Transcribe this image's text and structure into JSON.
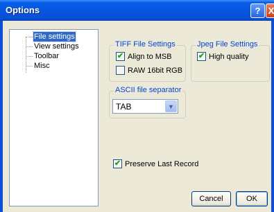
{
  "window": {
    "title": "Options",
    "help_glyph": "?",
    "close_glyph": "X"
  },
  "tree": {
    "items": [
      {
        "label": "File settings",
        "selected": true
      },
      {
        "label": "View settings",
        "selected": false
      },
      {
        "label": "Toolbar",
        "selected": false
      },
      {
        "label": "Misc",
        "selected": false
      }
    ]
  },
  "tiff": {
    "legend": "TIFF File Settings",
    "align_msb": {
      "label": "Align to MSB",
      "checked": true
    },
    "raw16": {
      "label": "RAW 16bit RGB",
      "checked": false
    }
  },
  "jpeg": {
    "legend": "Jpeg File Settings",
    "high_quality": {
      "label": "High quality",
      "checked": true
    }
  },
  "ascii": {
    "legend": "ASCII file separator",
    "value": "TAB"
  },
  "preserve": {
    "label": "Preserve Last Record",
    "checked": true
  },
  "buttons": {
    "cancel": "Cancel",
    "ok": "OK"
  },
  "icons": {
    "check": "check-icon",
    "dropdown": "chevron-down-icon"
  },
  "colors": {
    "title_bar": "#0756df",
    "selection": "#316ac5",
    "legend_text": "#0046d5",
    "face": "#ece9d8"
  }
}
